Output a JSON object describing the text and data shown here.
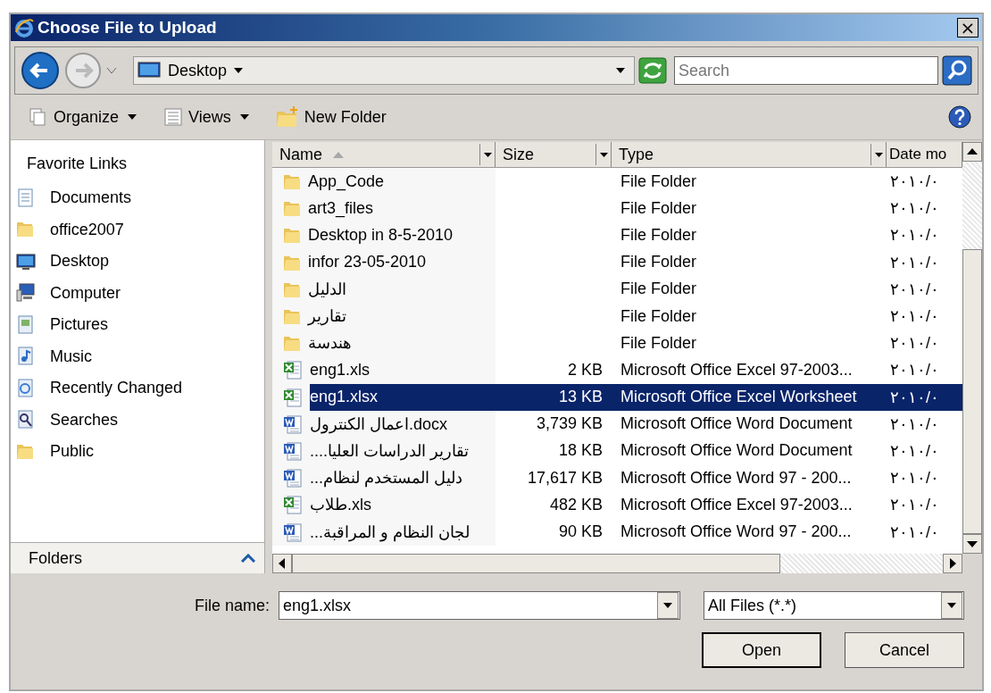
{
  "window": {
    "title": "Choose File to Upload",
    "close": "×"
  },
  "address": {
    "location": "Desktop",
    "search_placeholder": "Search"
  },
  "toolbar": [
    {
      "label": "Organize",
      "dropdown": true
    },
    {
      "label": "Views",
      "dropdown": true
    },
    {
      "label": "New Folder",
      "dropdown": false
    }
  ],
  "sidebar": {
    "heading": "Favorite Links",
    "items": [
      {
        "label": "Documents"
      },
      {
        "label": "office2007"
      },
      {
        "label": "Desktop"
      },
      {
        "label": "Computer"
      },
      {
        "label": "Pictures"
      },
      {
        "label": "Music"
      },
      {
        "label": "Recently Changed"
      },
      {
        "label": "Searches"
      },
      {
        "label": "Public"
      }
    ],
    "folders": "Folders",
    "folders_expanded": false
  },
  "table": {
    "columns": [
      "Name",
      "Size",
      "Type",
      "Date mo"
    ],
    "rows": [
      {
        "kind": "folder",
        "name": "App_Code",
        "size": "",
        "type": "File Folder",
        "date": "٢٠١٠/٠",
        "selected": false
      },
      {
        "kind": "folder",
        "name": "art3_files",
        "size": "",
        "type": "File Folder",
        "date": "٢٠١٠/٠",
        "selected": false
      },
      {
        "kind": "folder",
        "name": "Desktop in 8-5-2010",
        "size": "",
        "type": "File Folder",
        "date": "٢٠١٠/٠",
        "selected": false
      },
      {
        "kind": "folder",
        "name": "infor 23-05-2010",
        "size": "",
        "type": "File Folder",
        "date": "٢٠١٠/٠",
        "selected": false
      },
      {
        "kind": "folder",
        "name": "الدليل",
        "size": "",
        "type": "File Folder",
        "date": "٢٠١٠/٠",
        "selected": false
      },
      {
        "kind": "folder",
        "name": "تقارير",
        "size": "",
        "type": "File Folder",
        "date": "٢٠١٠/٠",
        "selected": false
      },
      {
        "kind": "folder",
        "name": "هندسة",
        "size": "",
        "type": "File Folder",
        "date": "٢٠١٠/٠",
        "selected": false
      },
      {
        "kind": "excel",
        "name": "eng1.xls",
        "size": "2 KB",
        "type": "Microsoft Office Excel 97-2003...",
        "date": "٢٠١٠/٠",
        "selected": false
      },
      {
        "kind": "excel",
        "name": "eng1.xlsx",
        "size": "13 KB",
        "type": "Microsoft Office Excel Worksheet",
        "date": "٢٠١٠/٠",
        "selected": true
      },
      {
        "kind": "word",
        "name": "اعمال الكنترول.docx",
        "size": "3,739 KB",
        "type": "Microsoft Office Word Document",
        "date": "٢٠١٠/٠",
        "selected": false
      },
      {
        "kind": "word",
        "name": "....تقارير الدراسات العليا",
        "size": "18 KB",
        "type": "Microsoft Office Word Document",
        "date": "٢٠١٠/٠",
        "selected": false
      },
      {
        "kind": "word",
        "name": "...دليل المستخدم لنظام",
        "size": "17,617 KB",
        "type": "Microsoft Office Word 97 - 200...",
        "date": "٢٠١٠/٠",
        "selected": false
      },
      {
        "kind": "excel",
        "name": "طلاب.xls",
        "size": "482 KB",
        "type": "Microsoft Office Excel 97-2003...",
        "date": "٢٠١٠/٠",
        "selected": false
      },
      {
        "kind": "word",
        "name": "...لجان النظام و المراقبة",
        "size": "90 KB",
        "type": "Microsoft Office Word 97 - 200...",
        "date": "٢٠١٠/٠",
        "selected": false
      }
    ]
  },
  "file_name": {
    "label": "File name:",
    "value": "eng1.xlsx"
  },
  "filter": {
    "value": "All Files (*.*)"
  },
  "buttons": [
    "Open",
    "Cancel"
  ]
}
